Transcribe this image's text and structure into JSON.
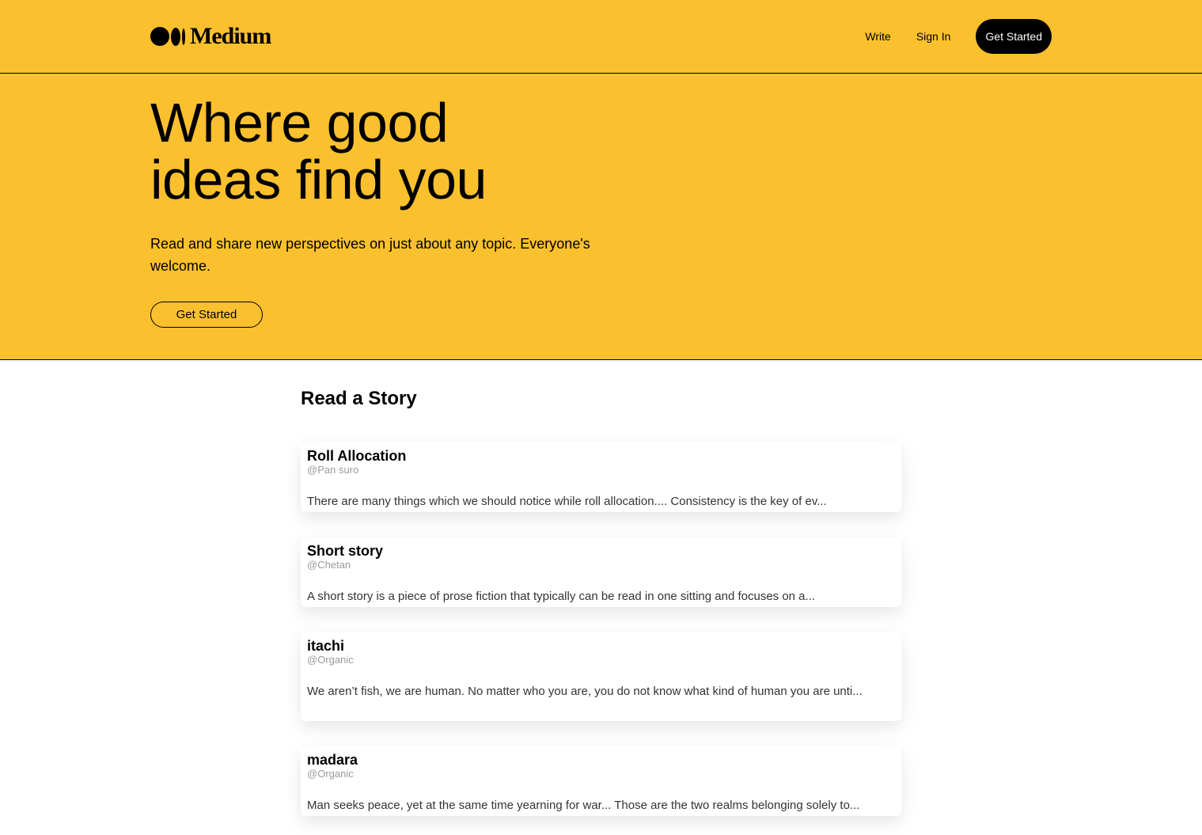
{
  "header": {
    "brand": "Medium",
    "nav": {
      "write": "Write",
      "sign_in": "Sign In",
      "get_started": "Get Started"
    }
  },
  "hero": {
    "title_line1": "Where good",
    "title_line2": "ideas find you",
    "subtitle": "Read and share new perspectives on just about any topic. Everyone's welcome.",
    "cta": "Get Started"
  },
  "stories": {
    "heading": "Read a Story",
    "items": [
      {
        "title": "Roll Allocation",
        "author": "@Pan suro",
        "excerpt": "There are many things which we should notice while roll allocation.... Consistency is the key of ev..."
      },
      {
        "title": "Short story",
        "author": "@Chetan",
        "excerpt": "A short story is a piece of prose fiction that typically can be read in one sitting and focuses on a..."
      },
      {
        "title": "itachi",
        "author": "@Organic",
        "excerpt": "We aren’t fish, we are human. No matter who you are, you do not know what kind of human you are unti..."
      },
      {
        "title": "madara",
        "author": "@Organic",
        "excerpt": "Man seeks peace, yet at the same time yearning for war... Those are the two realms belonging solely to..."
      }
    ]
  },
  "colors": {
    "brand_yellow": "#fbc02d",
    "black": "#000000",
    "muted": "#9a9a9a"
  }
}
